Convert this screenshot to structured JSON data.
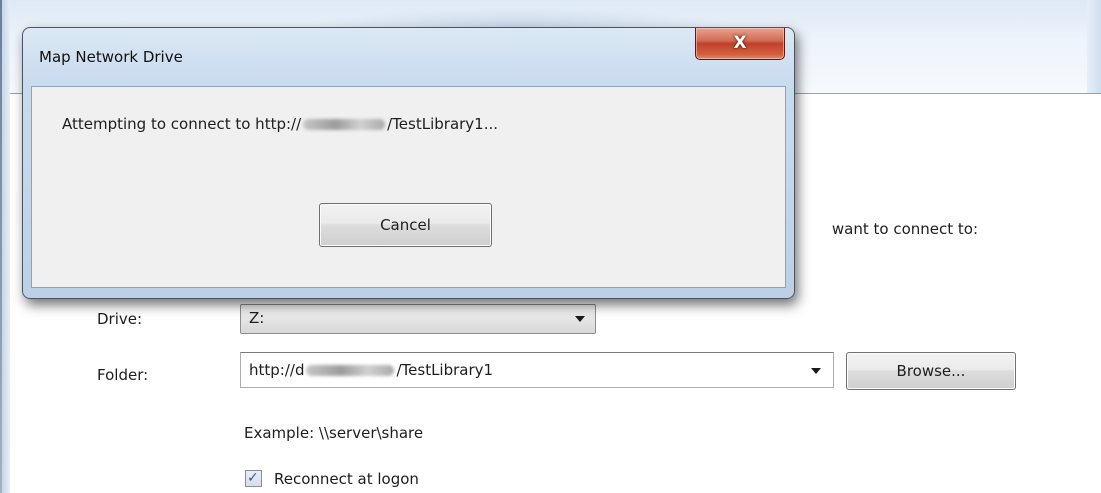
{
  "background_window": {
    "instruction_text": "want to connect to:",
    "drive": {
      "label": "Drive:",
      "value": "Z:"
    },
    "folder": {
      "label": "Folder:",
      "value_prefix": "http://d",
      "value_suffix": "/TestLibrary1"
    },
    "browse_label": "Browse...",
    "example_text": "Example: \\\\server\\share",
    "reconnect": {
      "label": "Reconnect at logon",
      "checked": true
    }
  },
  "dialog": {
    "title": "Map Network Drive",
    "close_icon": "close-icon",
    "message_prefix": "Attempting to connect to http://",
    "message_suffix": "/TestLibrary1...",
    "cancel_label": "Cancel"
  },
  "colors": {
    "close_button": "#c0412a",
    "dialog_frame": "#c9dbee",
    "dialog_body": "#f0f0f0"
  }
}
